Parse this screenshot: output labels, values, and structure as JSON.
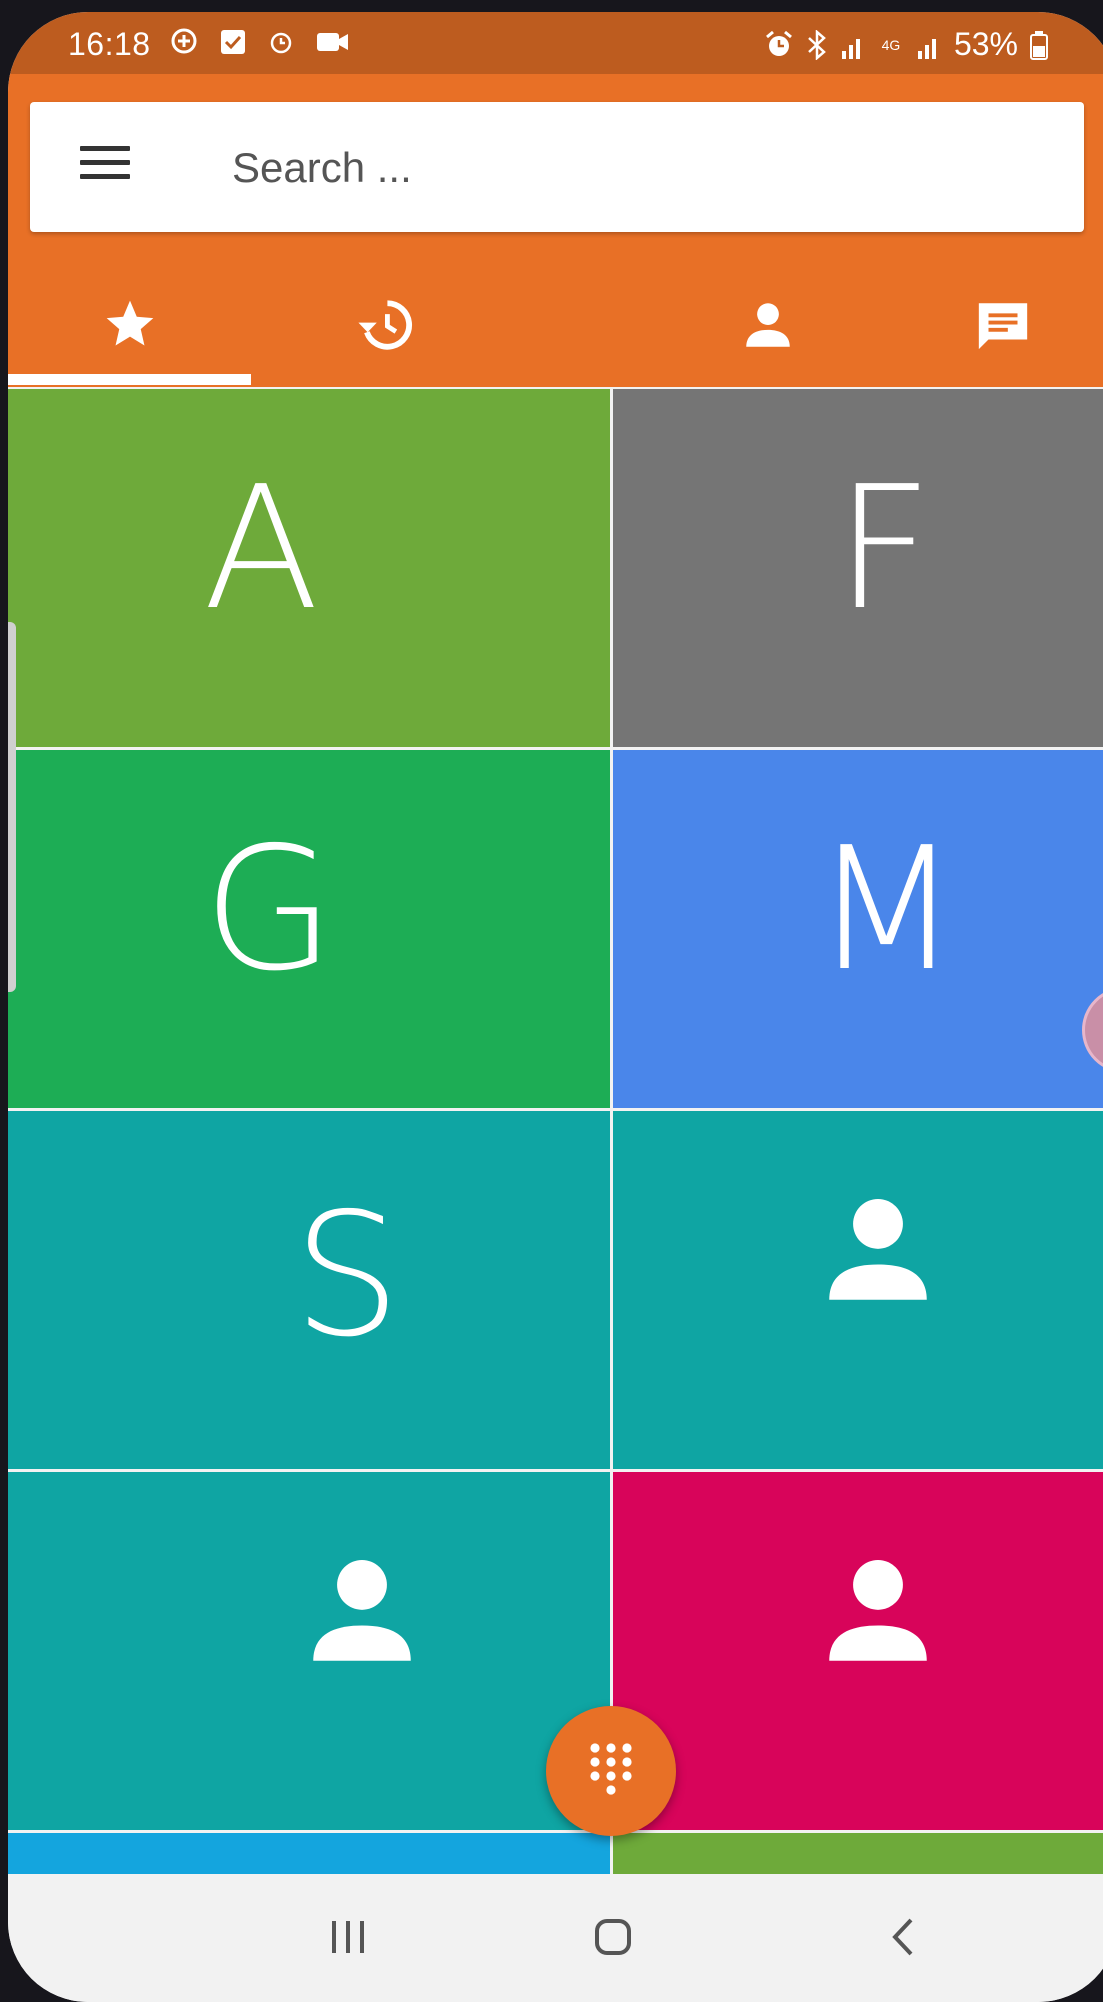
{
  "status_bar": {
    "time": "16:18",
    "battery": "53%",
    "network_label": "4G"
  },
  "search": {
    "placeholder": "Search ..."
  },
  "tabs": [
    {
      "name": "favorites",
      "icon": "star-icon",
      "selected": true
    },
    {
      "name": "recents",
      "icon": "history-icon",
      "selected": false
    },
    {
      "name": "contacts",
      "icon": "person-icon",
      "selected": false
    },
    {
      "name": "messages",
      "icon": "message-icon",
      "selected": false
    }
  ],
  "favorites": [
    {
      "letter": "A",
      "color": "#6eaa3a"
    },
    {
      "letter": "F",
      "color": "#757575"
    },
    {
      "letter": "G",
      "color": "#1dad55"
    },
    {
      "letter": "M",
      "color": "#4a86ea"
    },
    {
      "letter": "S",
      "color": "#0fa5a3"
    },
    {
      "letter": "",
      "icon": "person-icon",
      "color": "#0fa5a3"
    },
    {
      "letter": "",
      "icon": "person-icon",
      "color": "#0fa5a3"
    },
    {
      "letter": "",
      "icon": "person-icon",
      "color": "#d8045a"
    },
    {
      "letter": "",
      "color": "#14a5de"
    },
    {
      "letter": "",
      "color": "#6eaa3a"
    }
  ],
  "colors": {
    "accent": "#e87026",
    "status_bar": "#bd5c1f"
  }
}
